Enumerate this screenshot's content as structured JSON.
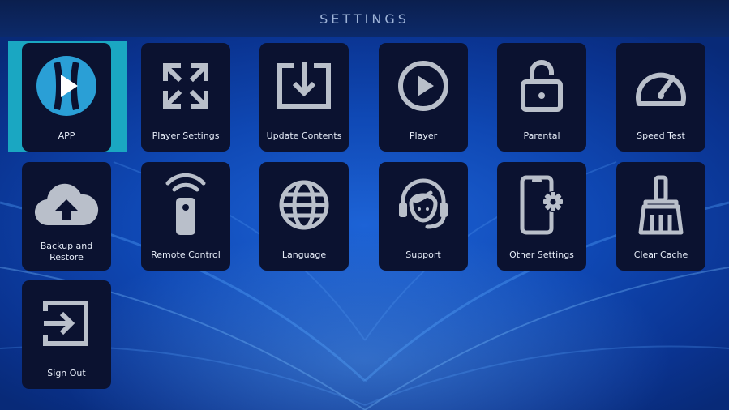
{
  "header": {
    "title": "SETTINGS"
  },
  "colors": {
    "accent": "#1aa7c2",
    "tile_bg": "#0b1230",
    "icon_gray": "#b9bfca",
    "background": "#0f48b4"
  },
  "tiles": [
    {
      "label": "APP",
      "icon": "app-logo-icon",
      "selected": true
    },
    {
      "label": "Player Settings",
      "icon": "expand-arrows-icon"
    },
    {
      "label": "Update Contents",
      "icon": "download-box-icon"
    },
    {
      "label": "Player",
      "icon": "play-circle-icon"
    },
    {
      "label": "Parental",
      "icon": "unlock-icon"
    },
    {
      "label": "Speed Test",
      "icon": "speedometer-icon"
    },
    {
      "label": "Backup and\nRestore",
      "icon": "cloud-upload-icon"
    },
    {
      "label": "Remote Control",
      "icon": "remote-control-icon"
    },
    {
      "label": "Language",
      "icon": "globe-icon"
    },
    {
      "label": "Support",
      "icon": "headset-icon"
    },
    {
      "label": "Other Settings",
      "icon": "phone-gear-icon"
    },
    {
      "label": "Clear Cache",
      "icon": "broom-icon"
    },
    {
      "label": "Sign Out",
      "icon": "sign-out-icon"
    }
  ]
}
